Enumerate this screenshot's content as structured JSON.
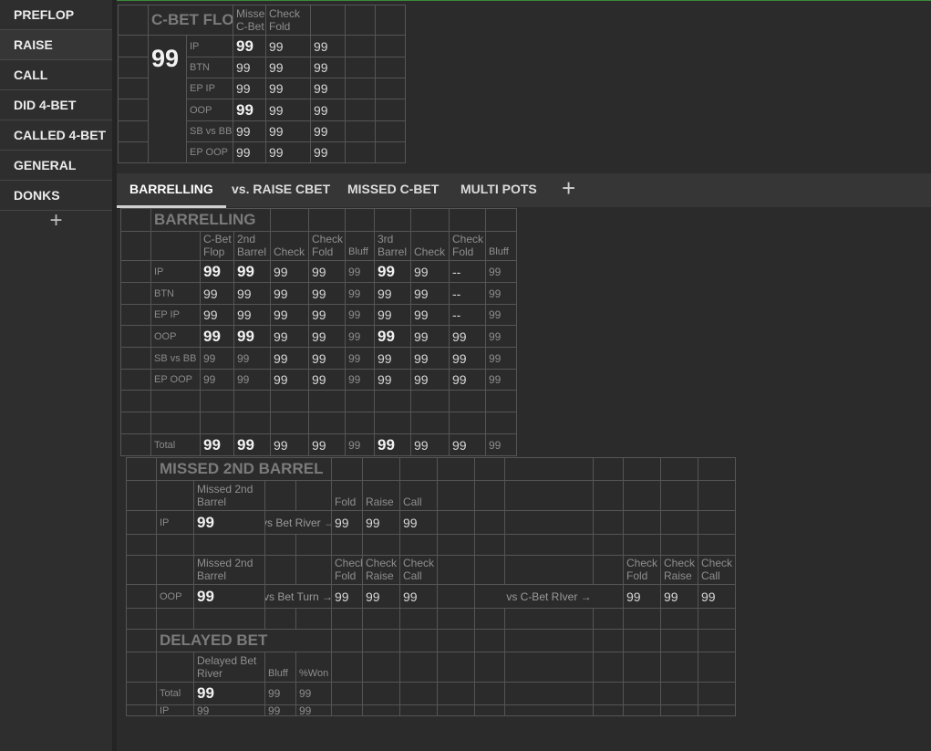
{
  "sidebar": {
    "items": [
      {
        "label": "PREFLOP"
      },
      {
        "label": "RAISE"
      },
      {
        "label": "CALL"
      },
      {
        "label": "DID 4-BET"
      },
      {
        "label": "CALLED 4-BET"
      },
      {
        "label": "GENERAL"
      },
      {
        "label": "DONKS"
      }
    ],
    "active_index": 1,
    "add_symbol": "+"
  },
  "cbet": {
    "title": "C-BET FLOP",
    "big_value": "99",
    "headers": [
      "Missed C-Bet",
      "Check Fold"
    ],
    "rows": [
      {
        "label": "IP",
        "values": [
          "99",
          "99",
          "99"
        ],
        "bold": [
          true,
          false,
          false
        ]
      },
      {
        "label": "BTN",
        "values": [
          "99",
          "99",
          "99"
        ],
        "bold": [
          false,
          false,
          false
        ]
      },
      {
        "label": "EP IP",
        "values": [
          "99",
          "99",
          "99"
        ],
        "bold": [
          false,
          false,
          false
        ]
      },
      {
        "label": "OOP",
        "values": [
          "99",
          "99",
          "99"
        ],
        "bold": [
          true,
          false,
          false
        ]
      },
      {
        "label": "SB vs BB",
        "values": [
          "99",
          "99",
          "99"
        ],
        "bold": [
          false,
          false,
          false
        ]
      },
      {
        "label": "EP OOP",
        "values": [
          "99",
          "99",
          "99"
        ],
        "bold": [
          false,
          false,
          false
        ]
      }
    ]
  },
  "tabs": {
    "items": [
      {
        "label": "BARRELLING"
      },
      {
        "label": "vs. RAISE CBET"
      },
      {
        "label": "MISSED C-BET"
      },
      {
        "label": "MULTI POTS"
      }
    ],
    "active_index": 0,
    "add_symbol": "+"
  },
  "barrelling": {
    "title": "BARRELLING",
    "headers": [
      "C-Bet Flop",
      "2nd Barrel",
      "Check",
      "Check Fold",
      "Bluff",
      "3rd Barrel",
      "Check",
      "Check Fold",
      "Bluff"
    ],
    "rows": [
      {
        "label": "IP",
        "values": [
          "99",
          "99",
          "99",
          "99",
          "99",
          "99",
          "99",
          "--",
          "99"
        ],
        "styles": [
          "vb",
          "vb",
          "v",
          "v",
          "vd",
          "vb",
          "v",
          "v",
          "vd"
        ]
      },
      {
        "label": "BTN",
        "values": [
          "99",
          "99",
          "99",
          "99",
          "99",
          "99",
          "99",
          "--",
          "99"
        ],
        "styles": [
          "v",
          "v",
          "v",
          "v",
          "vd",
          "v",
          "v",
          "v",
          "vd"
        ]
      },
      {
        "label": "EP IP",
        "values": [
          "99",
          "99",
          "99",
          "99",
          "99",
          "99",
          "99",
          "--",
          "99"
        ],
        "styles": [
          "v",
          "v",
          "v",
          "v",
          "vd",
          "v",
          "v",
          "v",
          "vd"
        ]
      },
      {
        "label": "OOP",
        "values": [
          "99",
          "99",
          "99",
          "99",
          "99",
          "99",
          "99",
          "99",
          "99"
        ],
        "styles": [
          "vb",
          "vb",
          "v",
          "v",
          "vd",
          "vb",
          "v",
          "v",
          "vd"
        ]
      },
      {
        "label": "SB vs BB",
        "values": [
          "99",
          "99",
          "99",
          "99",
          "99",
          "99",
          "99",
          "99",
          "99"
        ],
        "styles": [
          "vd",
          "vd",
          "v",
          "v",
          "vd",
          "v",
          "v",
          "v",
          "vd"
        ]
      },
      {
        "label": "EP OOP",
        "values": [
          "99",
          "99",
          "99",
          "99",
          "99",
          "99",
          "99",
          "99",
          "99"
        ],
        "styles": [
          "vd",
          "vd",
          "v",
          "v",
          "vd",
          "v",
          "v",
          "v",
          "vd"
        ]
      }
    ],
    "total": {
      "label": "Total",
      "values": [
        "99",
        "99",
        "99",
        "99",
        "99",
        "99",
        "99",
        "99",
        "99"
      ],
      "styles": [
        "vb",
        "vb",
        "v",
        "v",
        "vd",
        "vb",
        "v",
        "v",
        "vd"
      ]
    }
  },
  "missed2": {
    "title": "MISSED 2ND BARREL",
    "block_ip": {
      "header_missed": "Missed 2nd Barrel",
      "headers": [
        "Fold",
        "Raise",
        "Call"
      ],
      "label": "IP",
      "value": "99",
      "arrow": "vs Bet River →",
      "values": [
        "99",
        "99",
        "99"
      ]
    },
    "block_oop": {
      "header_missed": "Missed 2nd Barrel",
      "headers": [
        "Check Fold",
        "Check Raise",
        "Check Call"
      ],
      "headers2": [
        "Check Fold",
        "Check Raise",
        "Check Call"
      ],
      "label": "OOP",
      "value": "99",
      "arrow": "vs Bet Turn →",
      "values": [
        "99",
        "99",
        "99"
      ],
      "arrow2": "vs C-Bet RIver →",
      "values2": [
        "99",
        "99",
        "99"
      ]
    }
  },
  "delayed": {
    "title": "DELAYED BET",
    "headers": [
      "Delayed Bet River",
      "Bluff",
      "%Won"
    ],
    "rows": [
      {
        "label": "Total",
        "values": [
          "99",
          "99",
          "99"
        ]
      },
      {
        "label": "IP",
        "values": [
          "99",
          "99",
          "99"
        ]
      }
    ]
  }
}
